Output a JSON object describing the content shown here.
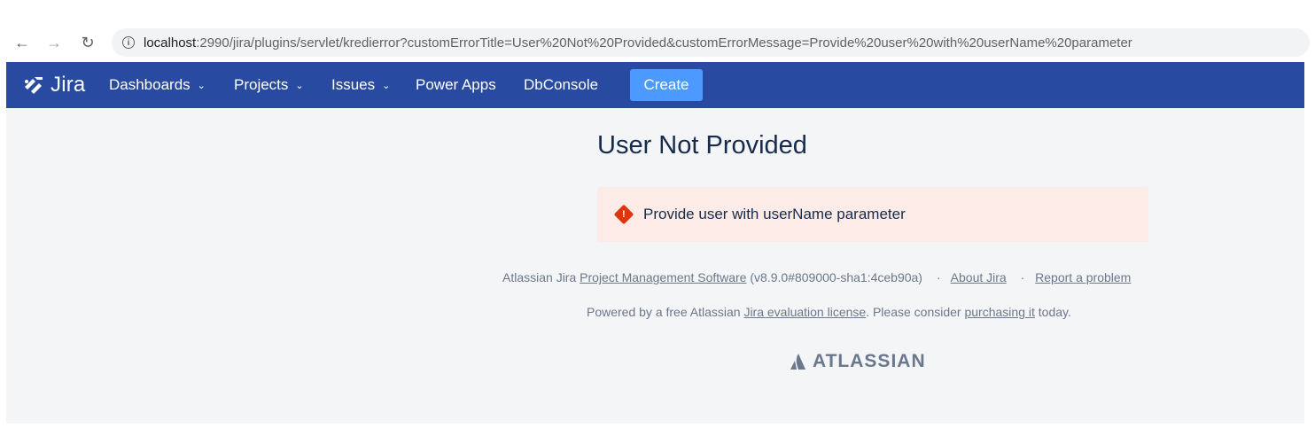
{
  "browser": {
    "url_host": "localhost",
    "url_rest": ":2990/jira/plugins/servlet/kredierror?customErrorTitle=User%20Not%20Provided&customErrorMessage=Provide%20user%20with%20userName%20parameter",
    "back_icon": "←",
    "forward_icon": "→",
    "reload_icon": "↻",
    "info_icon": "i"
  },
  "nav": {
    "logo_text": "Jira",
    "items": [
      {
        "label": "Dashboards",
        "dropdown": "⌄"
      },
      {
        "label": "Projects",
        "dropdown": "⌄"
      },
      {
        "label": "Issues",
        "dropdown": "⌄"
      },
      {
        "label": "Power Apps"
      },
      {
        "label": "DbConsole"
      }
    ],
    "create_label": "Create"
  },
  "main": {
    "title": "User Not Provided",
    "error_message": "Provide user with userName parameter",
    "error_icon": "!"
  },
  "footer": {
    "line1_prefix": "Atlassian Jira ",
    "line1_link": "Project Management Software",
    "line1_version": " (v8.9.0#809000-sha1:4ceb90a)",
    "separator": "·",
    "about_link": "About Jira",
    "report_link": "Report a problem",
    "line2_prefix": "Powered by a free Atlassian ",
    "line2_link1": "Jira evaluation license",
    "line2_middle": ". Please consider ",
    "line2_link2": "purchasing it",
    "line2_suffix": " today.",
    "brand": "ATLASSIAN"
  },
  "colors": {
    "nav_bg": "#284ba1",
    "create_bg": "#4c9aff",
    "error_bg": "#fcebe6",
    "error_icon": "#de350b"
  }
}
